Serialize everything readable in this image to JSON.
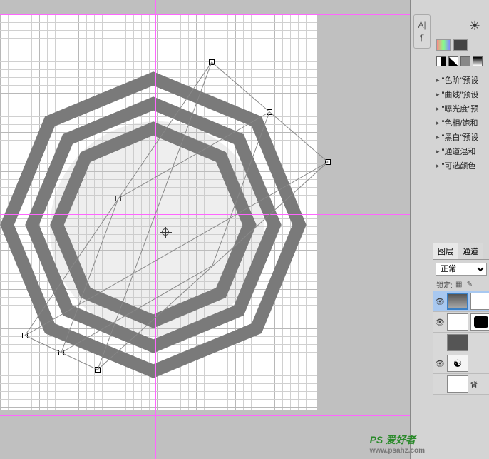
{
  "presets": [
    {
      "label": "\"色阶\"预设"
    },
    {
      "label": "\"曲线\"预设"
    },
    {
      "label": "\"曝光度\"预"
    },
    {
      "label": "\"色相/饱和"
    },
    {
      "label": "\"黑白\"预设"
    },
    {
      "label": "\"通道混和"
    },
    {
      "label": "\"可选颜色"
    }
  ],
  "layers_panel": {
    "tabs": [
      "图层",
      "通道"
    ],
    "blend_mode": "正常",
    "lock_label": "锁定:",
    "layers": [
      {
        "visible": true,
        "thumb": "gradient",
        "mask": "white",
        "label": ""
      },
      {
        "visible": true,
        "thumb": "white",
        "mask": "black-hole",
        "label": ""
      },
      {
        "visible": false,
        "thumb": "dark",
        "mask": "",
        "label": ""
      },
      {
        "visible": true,
        "thumb": "bagua",
        "mask": "",
        "label": ""
      },
      {
        "visible": false,
        "thumb": "empty",
        "mask": "",
        "label": "背"
      }
    ]
  },
  "guides": {
    "vertical": [
      218
    ],
    "horizontal": [
      20,
      300,
      582
    ]
  },
  "watermark": {
    "text": "PS 爱好者",
    "url": "www.psahz.com"
  }
}
